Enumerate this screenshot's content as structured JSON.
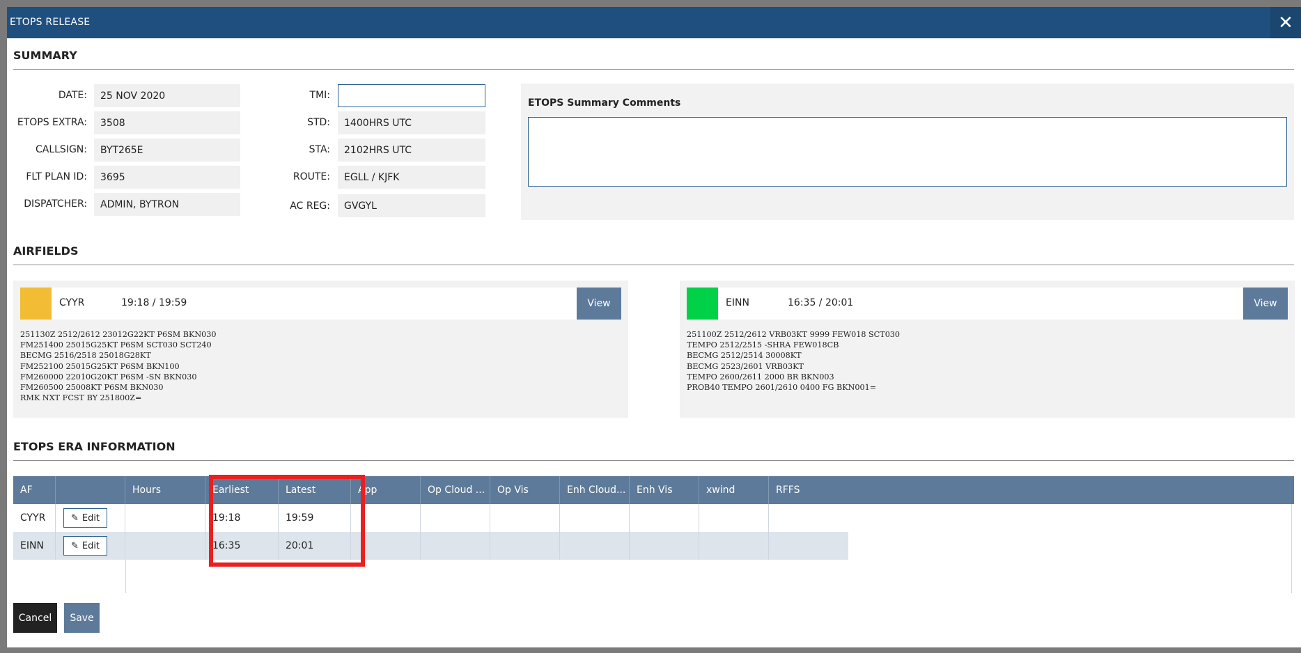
{
  "dialog": {
    "title": "ETOPS RELEASE",
    "close_glyph": "✕"
  },
  "summary": {
    "section_title": "SUMMARY",
    "left_fields": [
      {
        "label": "DATE:",
        "value": "25 NOV 2020"
      },
      {
        "label": "ETOPS EXTRA:",
        "value": "3508"
      },
      {
        "label": "CALLSIGN:",
        "value": "BYT265E"
      },
      {
        "label": "FLT PLAN ID:",
        "value": "3695"
      },
      {
        "label": "DISPATCHER:",
        "value": "ADMIN, BYTRON"
      }
    ],
    "tmi": {
      "label": "TMI:",
      "value": "",
      "placeholder": ""
    },
    "right_fields": [
      {
        "label": "STD:",
        "value": "1400HRS UTC"
      },
      {
        "label": "STA:",
        "value": "2102HRS UTC"
      },
      {
        "label": "ROUTE:",
        "value": "EGLL / KJFK"
      },
      {
        "label": "AC REG:",
        "value": "GVGYL"
      }
    ],
    "comments": {
      "label": "ETOPS Summary Comments",
      "value": ""
    }
  },
  "airfields": {
    "section_title": "AIRFIELDS",
    "cards": [
      {
        "code": "CYYR",
        "times": "19:18 / 19:59",
        "status_color": "#f2bd35",
        "view_label": "View",
        "taf": "251130Z 2512/2612 23012G22KT P6SM BKN030\nFM251400 25015G25KT P6SM SCT030 SCT240\nBECMG 2516/2518 25018G28KT\nFM252100 25015G25KT P6SM BKN100\nFM260000 22010G20KT P6SM -SN BKN030\nFM260500 25008KT P6SM BKN030\nRMK NXT FCST BY 251800Z="
      },
      {
        "code": "EINN",
        "times": "16:35 / 20:01",
        "status_color": "#00d146",
        "view_label": "View",
        "taf": "251100Z 2512/2612 VRB03KT 9999 FEW018 SCT030\nTEMPO 2512/2515 -SHRA FEW018CB\nBECMG 2512/2514 30008KT\nBECMG 2523/2601 VRB03KT\nTEMPO 2600/2611 2000 BR BKN003\nPROB40 TEMPO 2601/2610 0400 FG BKN001="
      }
    ]
  },
  "era": {
    "section_title": "ETOPS ERA INFORMATION",
    "columns": [
      "AF",
      "",
      "Hours",
      "Earliest",
      "Latest",
      "App",
      "Op Cloud ...",
      "Op Vis",
      "Enh Cloud...",
      "Enh Vis",
      "xwind",
      "RFFS"
    ],
    "edit_label": "Edit",
    "rows": [
      {
        "af": "CYYR",
        "hours": "",
        "earliest": "19:18",
        "latest": "19:59",
        "app": "",
        "op_cloud": "",
        "op_vis": "",
        "enh_cloud": "",
        "enh_vis": "",
        "xwind": "",
        "rffs": ""
      },
      {
        "af": "EINN",
        "hours": "",
        "earliest": "16:35",
        "latest": "20:01",
        "app": "",
        "op_cloud": "",
        "op_vis": "",
        "enh_cloud": "",
        "enh_vis": "",
        "xwind": "",
        "rffs": ""
      }
    ]
  },
  "footer": {
    "cancel_label": "Cancel",
    "save_label": "Save"
  },
  "colors": {
    "header": "#1f4f7e",
    "grid_header": "#5d7a9a",
    "highlight": "#ea2020"
  }
}
